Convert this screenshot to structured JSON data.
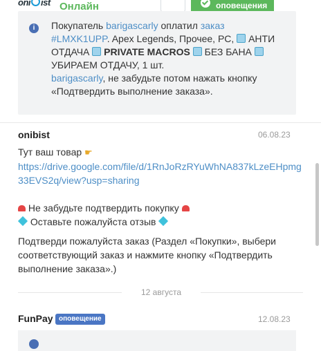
{
  "header": {
    "username": "onibist",
    "status": "Онлайн",
    "notifications_label": "оповещения",
    "more_glyph": "•••"
  },
  "system_message": {
    "icon": "info-icon",
    "line1": "Покупатель",
    "buyer": "barigascarly",
    "line1b": "оплатил",
    "order_word": "заказ",
    "order_id": "#LMXK1UPP",
    "order_desc_a": ". Apex Legends, Прочее, PC,",
    "order_desc_b": "АНТИ ОТДАЧА",
    "order_desc_c": "PRIVATE MACROS",
    "order_desc_d": "БЕЗ БАНА",
    "order_desc_e": "УБИРАЕМ ОТДАЧУ, 1 шт.",
    "buyer2": "barigascarly",
    "reminder": ", не забудьте потом нажать кнопку «Подтвердить выполнение заказа»."
  },
  "message": {
    "author": "onibist",
    "date": "06.08.23",
    "line1": "Тут ваш товар",
    "link": "https://drive.google.com/file/d/1RnJoRzRYuWhNA837kLzeEHpmg33EVS2q/view?usp=sharing",
    "warn": "Не забудьте подтвердить покупку",
    "review": "Оставьте пожалуйста отзыв",
    "confirm": "Подтверди пожалуйста заказ (Раздел «Покупки», выбери соответствующий заказ и нажмите кнопку «Подтвердить выполнение заказа».)"
  },
  "day_separator": "12 августа",
  "second_message": {
    "author": "FunPay",
    "badge": "оповещение",
    "date": "12.08.23"
  },
  "colors": {
    "online": "#5cb85c",
    "link": "#4d8ec6",
    "badge": "#4a76c4"
  }
}
